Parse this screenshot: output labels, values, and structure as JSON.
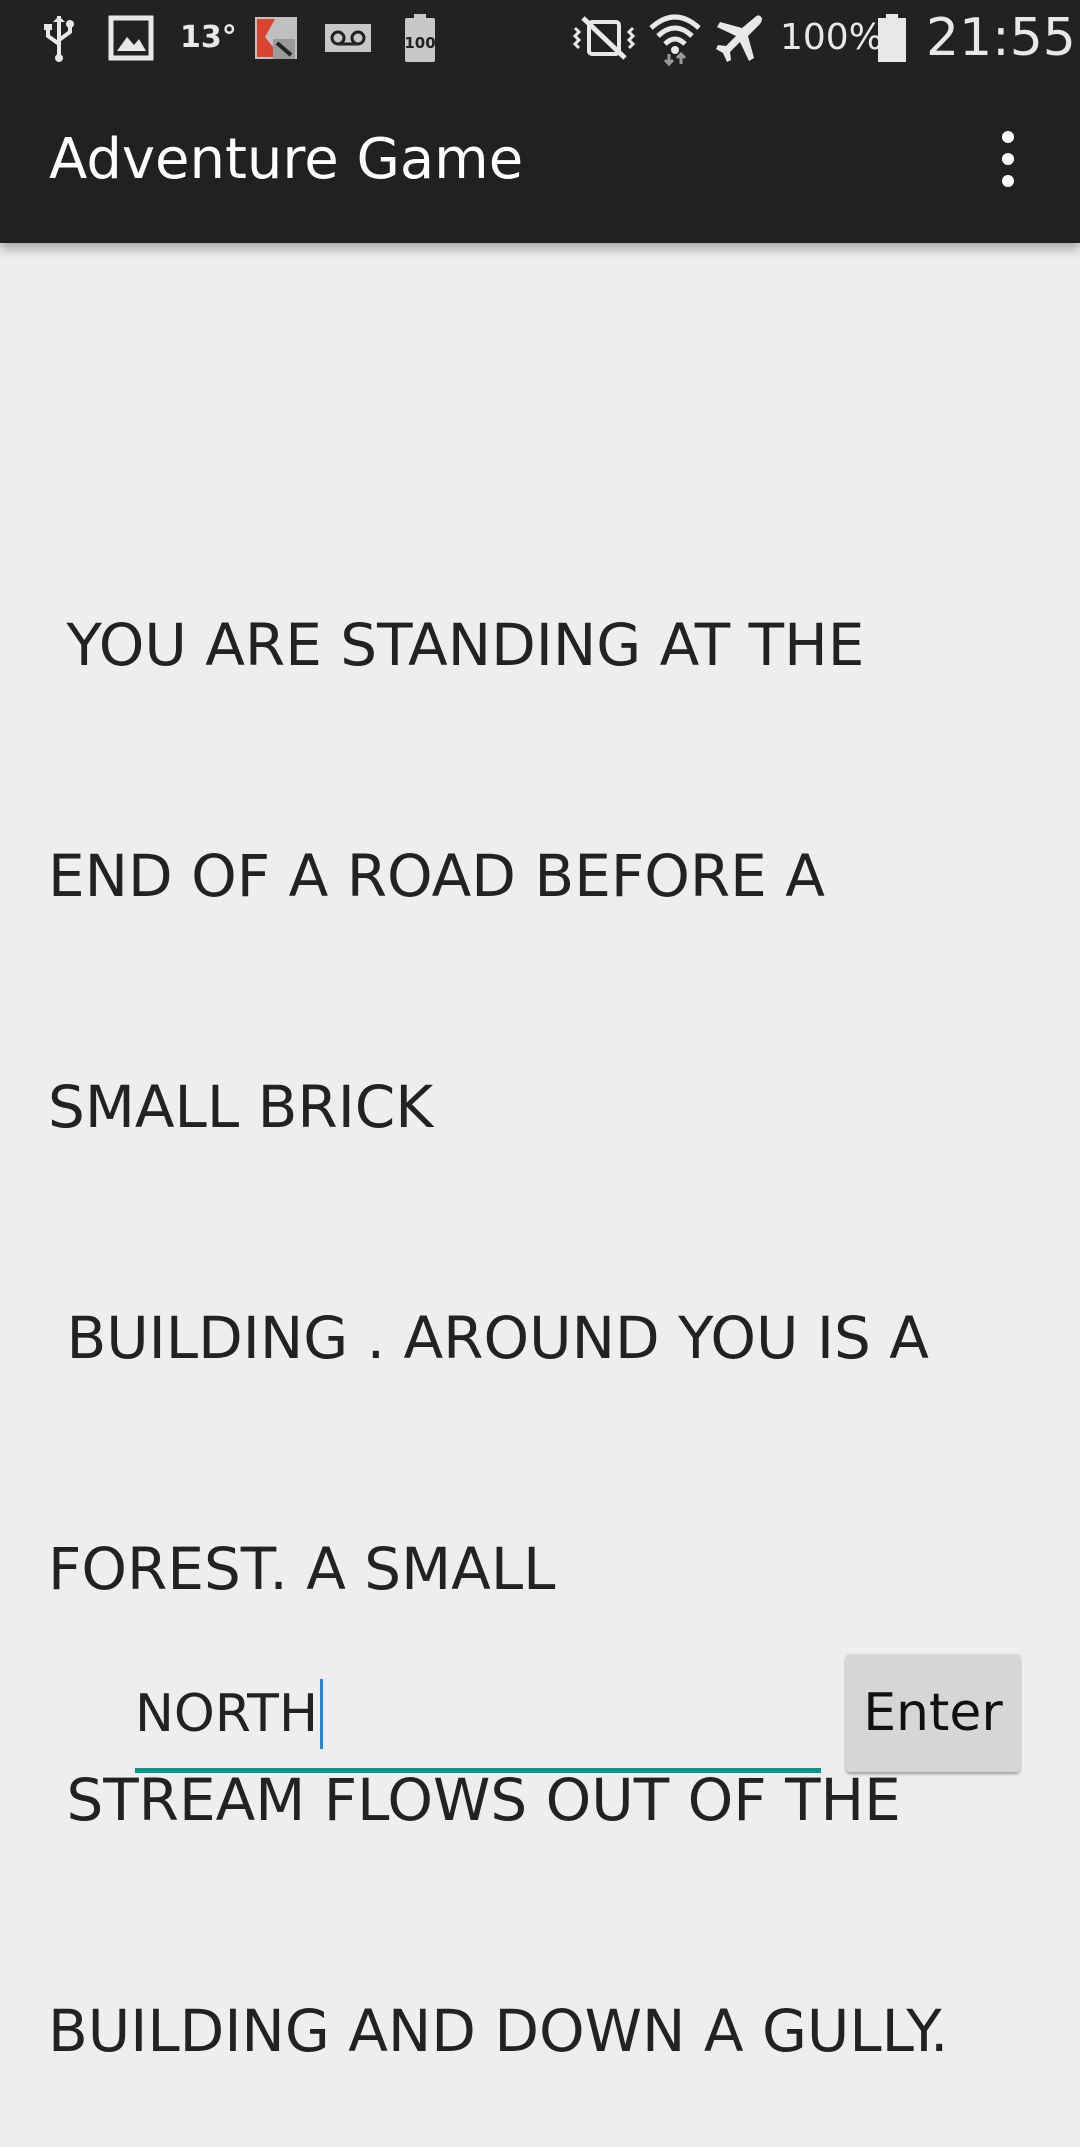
{
  "status_bar": {
    "icons_left": [
      "usb-icon",
      "image-icon",
      "temperature-icon",
      "kaspersky-icon",
      "voicemail-icon",
      "battery-100-icon"
    ],
    "temperature": "13°",
    "battery_small_label": "100",
    "icons_right": [
      "vibrate-mute-icon",
      "wifi-icon",
      "airplane-icon",
      "battery-icon"
    ],
    "battery_percent": "100%",
    "time": "21:55"
  },
  "app_bar": {
    "title": "Adventure Game",
    "overflow_icon": "more-vert-icon"
  },
  "content": {
    "story_lines": [
      " YOU ARE STANDING AT THE",
      "END OF A ROAD BEFORE A",
      "SMALL BRICK",
      " BUILDING . AROUND YOU IS A",
      "FOREST. A SMALL",
      " STREAM FLOWS OUT OF THE",
      "BUILDING AND DOWN A GULLY."
    ]
  },
  "command": {
    "value": "NORTH",
    "enter_label": "Enter"
  },
  "colors": {
    "status_bar_bg": "#222222",
    "app_bar_bg": "#212121",
    "page_bg": "#eeeeee",
    "field_underline": "#009688",
    "cursor": "#1e88e5",
    "button_bg": "#d6d6d6"
  }
}
